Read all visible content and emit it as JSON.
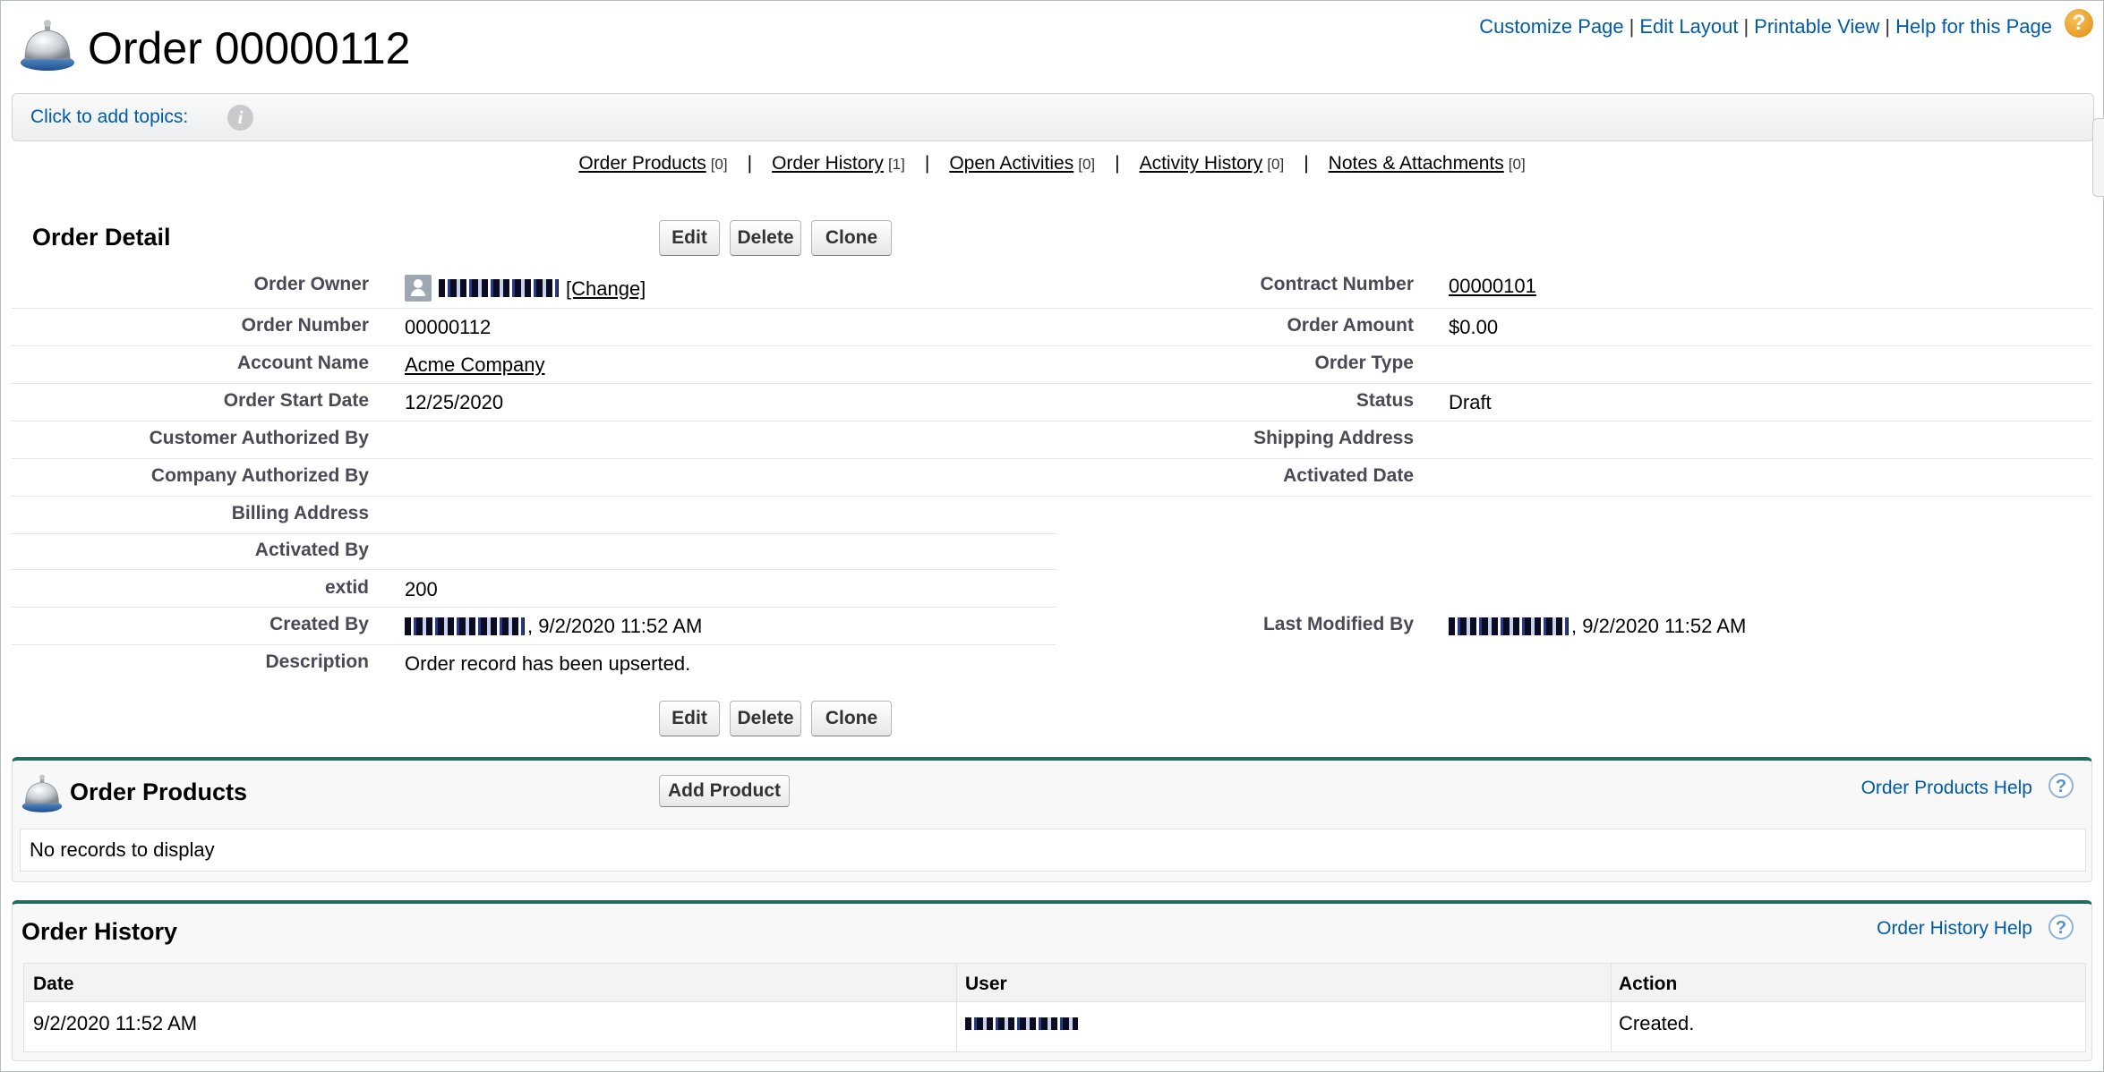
{
  "header": {
    "title": "Order 00000112",
    "links": [
      "Customize Page",
      "Edit Layout",
      "Printable View",
      "Help for this Page"
    ],
    "help_glyph": "?"
  },
  "topics": {
    "label": "Click to add topics:",
    "info_glyph": "i"
  },
  "related_links": [
    {
      "label": "Order Products",
      "count": "[0]"
    },
    {
      "label": "Order History",
      "count": "[1]"
    },
    {
      "label": "Open Activities",
      "count": "[0]"
    },
    {
      "label": "Activity History",
      "count": "[0]"
    },
    {
      "label": "Notes & Attachments",
      "count": "[0]"
    }
  ],
  "detail": {
    "title": "Order Detail",
    "buttons": {
      "edit": "Edit",
      "delete": "Delete",
      "clone": "Clone"
    },
    "left": [
      {
        "label": "Order Owner",
        "value": ""
      },
      {
        "label": "Order Number",
        "value": "00000112"
      },
      {
        "label": "Account Name",
        "value": "Acme Company"
      },
      {
        "label": "Order Start Date",
        "value": "12/25/2020"
      },
      {
        "label": "Customer Authorized By",
        "value": ""
      },
      {
        "label": "Company Authorized By",
        "value": ""
      },
      {
        "label": "Billing Address",
        "value": ""
      },
      {
        "label": "Activated By",
        "value": ""
      },
      {
        "label": "extid",
        "value": "200"
      },
      {
        "label": "Created By",
        "value": ", 9/2/2020 11:52 AM"
      },
      {
        "label": "Description",
        "value": "Order record has been upserted."
      }
    ],
    "owner_change": "[Change]",
    "right": [
      {
        "label": "Contract Number",
        "value": "00000101"
      },
      {
        "label": "Order Amount",
        "value": "$0.00"
      },
      {
        "label": "Order Type",
        "value": ""
      },
      {
        "label": "Status",
        "value": "Draft"
      },
      {
        "label": "Shipping Address",
        "value": ""
      },
      {
        "label": "Activated Date",
        "value": ""
      }
    ],
    "last_modified": {
      "label": "Last Modified By",
      "value": ", 9/2/2020 11:52 AM"
    }
  },
  "order_products": {
    "title": "Order Products",
    "add_button": "Add Product",
    "help_link": "Order Products Help",
    "empty": "No records to display"
  },
  "order_history": {
    "title": "Order History",
    "help_link": "Order History Help",
    "columns": [
      "Date",
      "User",
      "Action"
    ],
    "rows": [
      {
        "date": "9/2/2020 11:52 AM",
        "user": "",
        "action": "Created."
      }
    ]
  },
  "colors": {
    "accent_border": "#236b5c",
    "link": "#015ba7"
  }
}
